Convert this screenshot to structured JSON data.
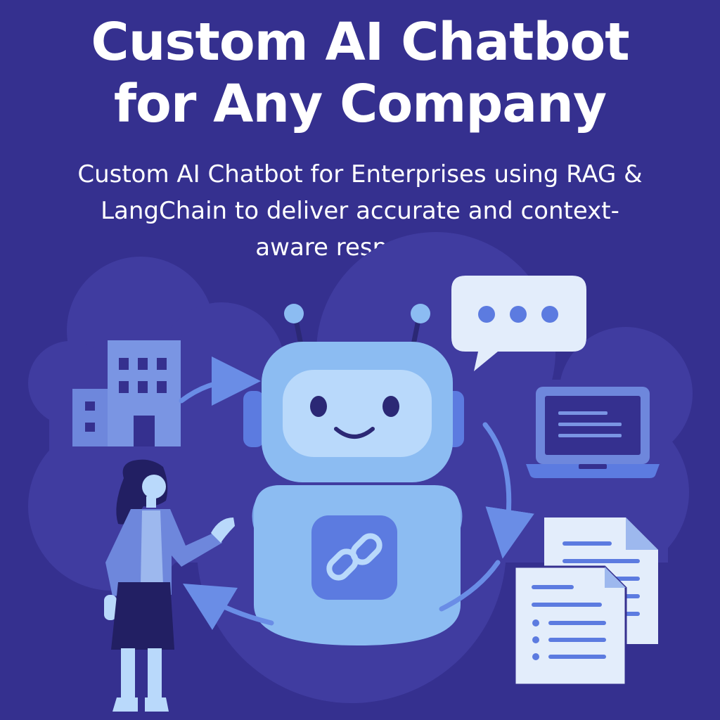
{
  "header": {
    "title_line1": "Custom AI Chatbot",
    "title_line2": "for Any Company",
    "subtitle": "Custom AI Chatbot for Enterprises using RAG & LangChain to deliver accurate and context-aware responses."
  },
  "illustration": {
    "icons": [
      "building-icon",
      "robot-icon",
      "link-icon",
      "chat-bubble-icon",
      "laptop-icon",
      "documents-icon",
      "person-icon",
      "arrow-icon"
    ]
  },
  "colors": {
    "background": "#35308f",
    "cloud": "#403ca0",
    "robot_light": "#8cbcf2",
    "robot_face": "#b9d9fb",
    "accent_blue": "#5c7be0",
    "paper": "#e3edfb",
    "title_text": "#ffffff"
  }
}
